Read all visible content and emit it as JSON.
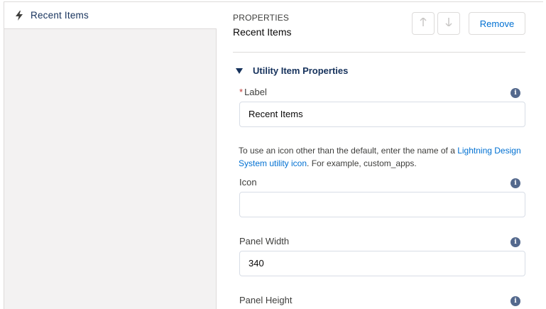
{
  "sidebar": {
    "items": [
      {
        "label": "Recent Items",
        "icon": "lightning-bolt-icon"
      }
    ]
  },
  "properties": {
    "eyebrow": "PROPERTIES",
    "title": "Recent Items",
    "remove_label": "Remove",
    "move_up_icon": "arrow-up-icon",
    "move_down_icon": "arrow-down-icon"
  },
  "section": {
    "title": "Utility Item Properties",
    "toggle_icon": "triangle-down-icon"
  },
  "fields": {
    "label": {
      "required_marker": "*",
      "label": "Label",
      "value": "Recent Items"
    },
    "help": {
      "before": "To use an icon other than the default, enter the name of a ",
      "link": "Lightning Design System utility icon",
      "after": ". For example, custom_apps."
    },
    "icon": {
      "label": "Icon",
      "value": ""
    },
    "panel_width": {
      "label": "Panel Width",
      "value": "340"
    },
    "panel_height": {
      "label": "Panel Height"
    }
  },
  "colors": {
    "link": "#0070d2",
    "heading": "#16325c",
    "border": "#dddbda",
    "left_panel_bg": "#f3f2f2",
    "required": "#c23934",
    "info_icon": "#54698d"
  }
}
